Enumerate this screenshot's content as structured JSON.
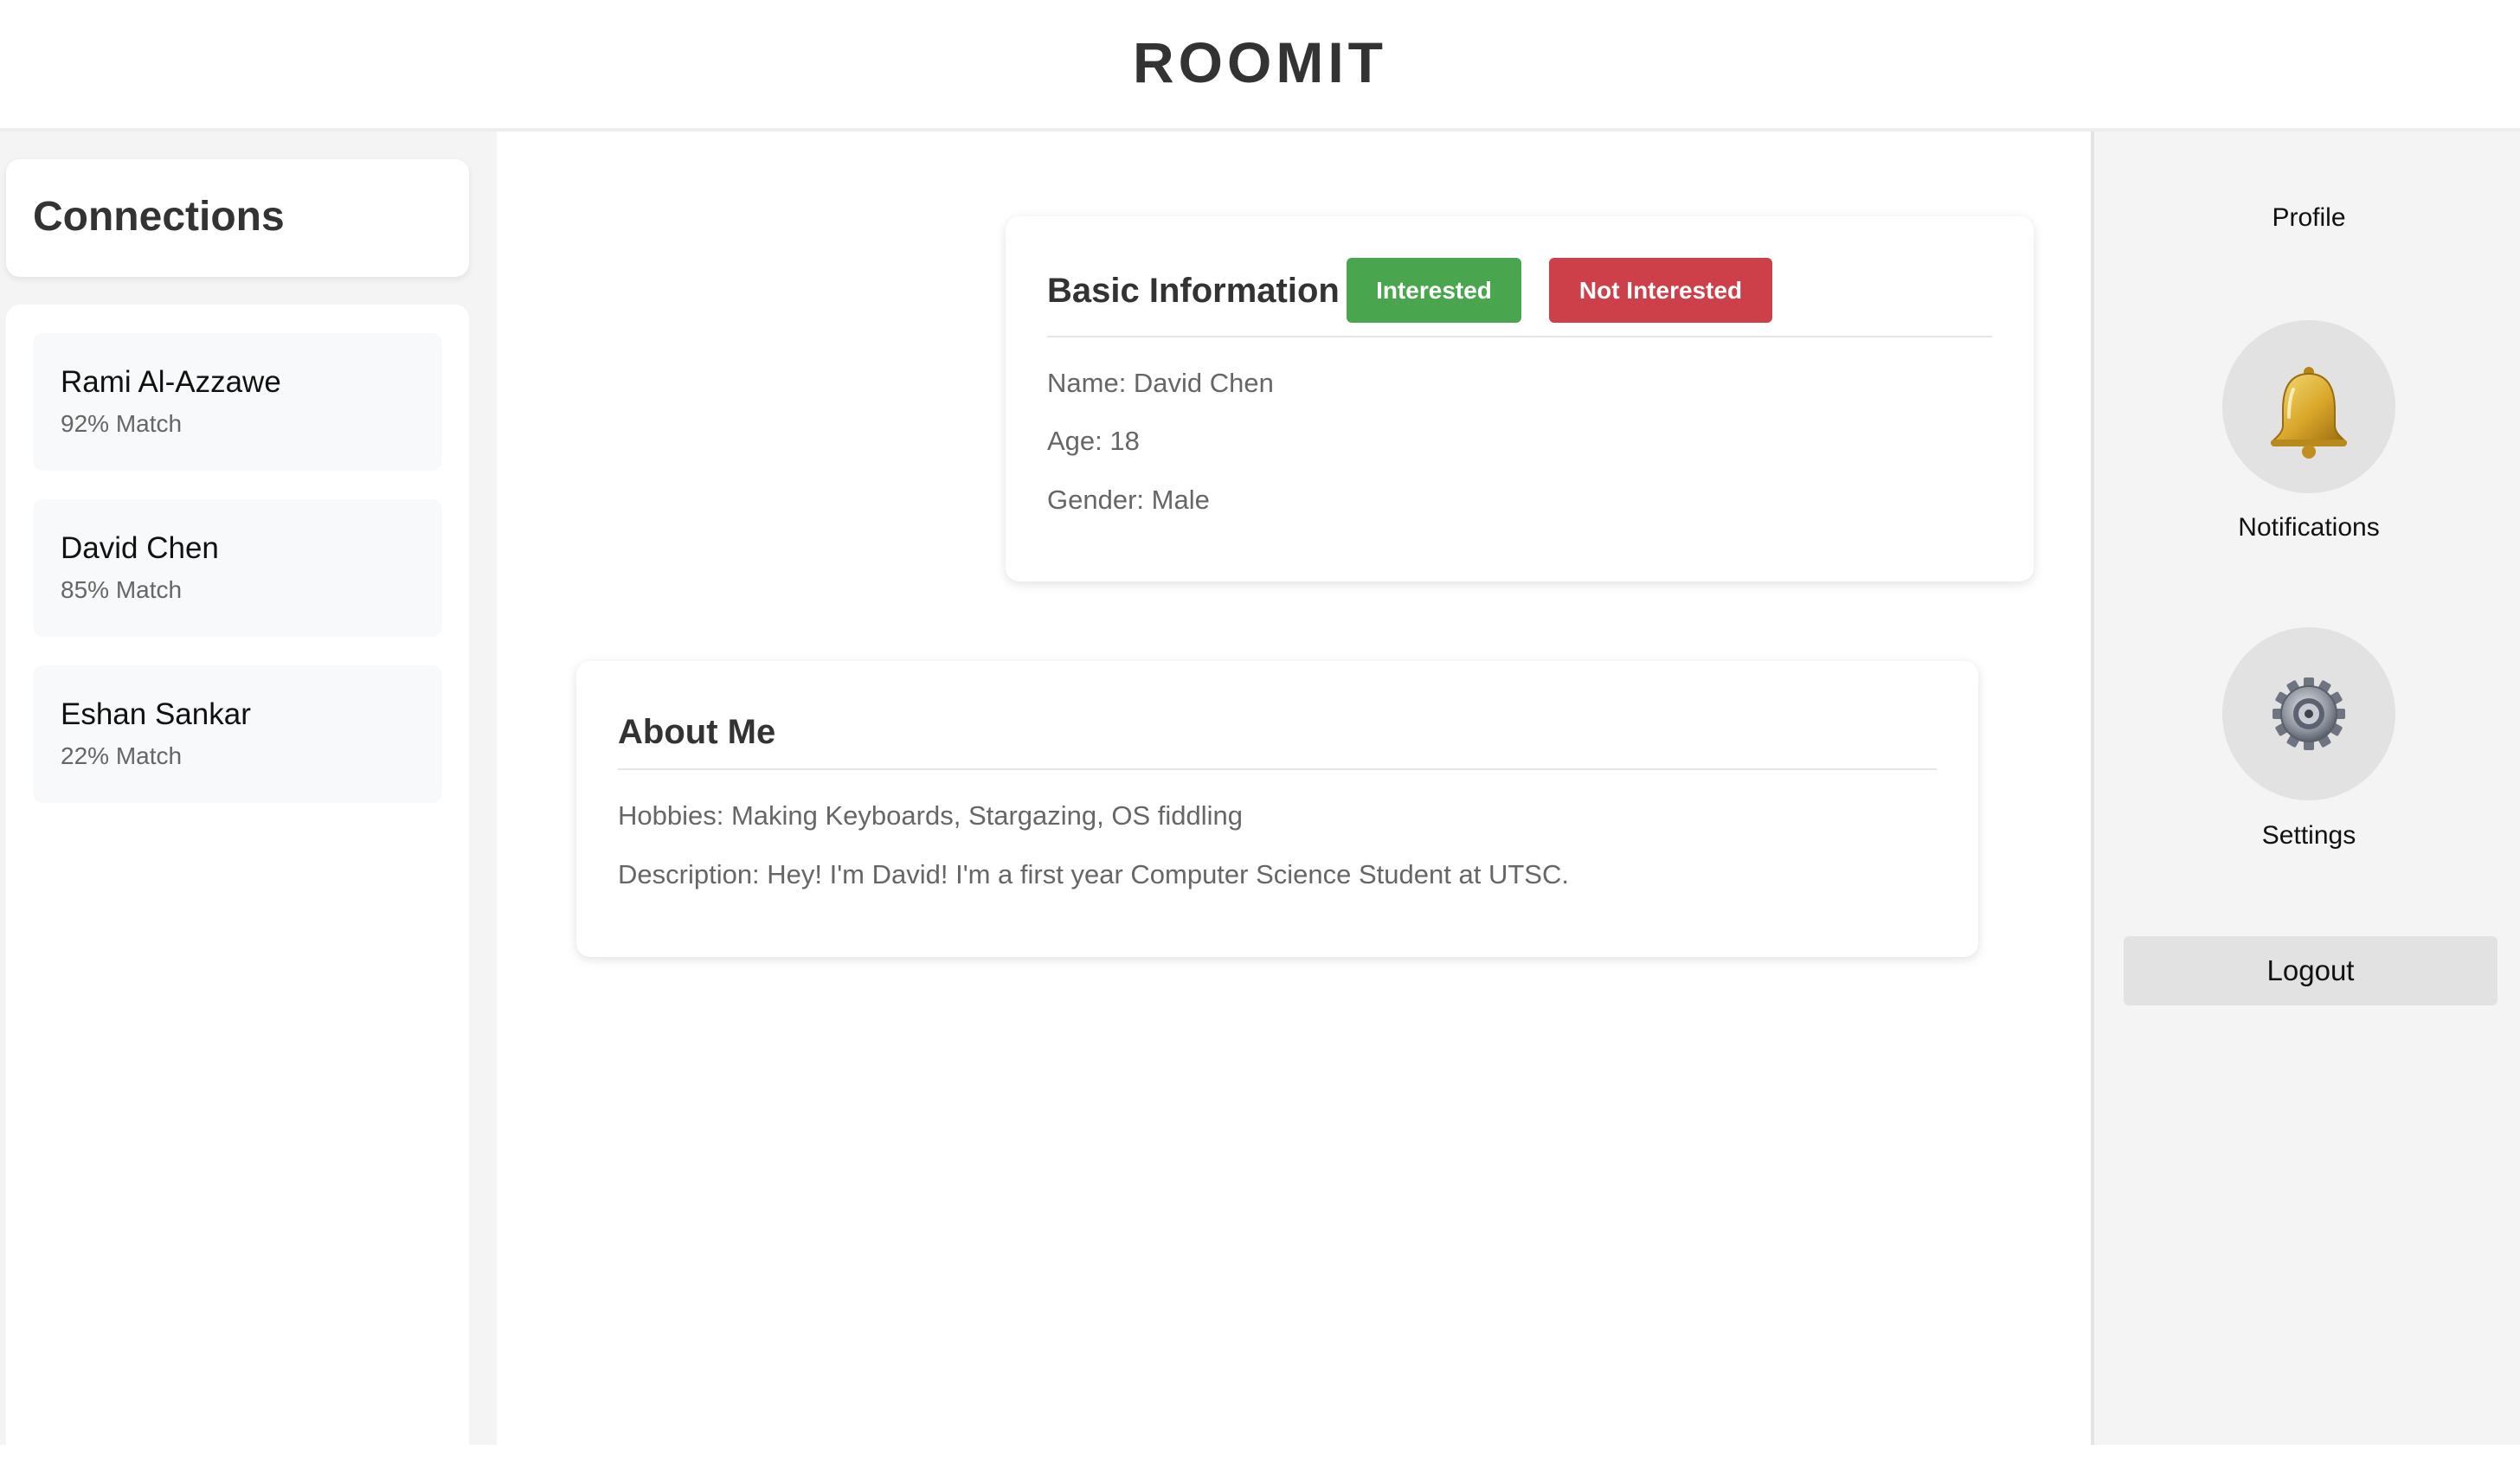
{
  "header": {
    "title": "ROOMIT"
  },
  "connections": {
    "title": "Connections",
    "items": [
      {
        "name": "Rami Al-Azzawe",
        "match": "92% Match"
      },
      {
        "name": "David Chen",
        "match": "85% Match"
      },
      {
        "name": "Eshan Sankar",
        "match": "22% Match"
      }
    ]
  },
  "profile": {
    "basic": {
      "title": "Basic Information",
      "interested_label": "Interested",
      "not_interested_label": "Not Interested",
      "name": "Name: David Chen",
      "age": "Age: 18",
      "gender": "Gender: Male"
    },
    "about": {
      "title": "About Me",
      "hobbies": "Hobbies: Making Keyboards, Stargazing, OS fiddling",
      "description": "Description: Hey! I'm David! I'm a first year Computer Science Student at UTSC."
    }
  },
  "nav": {
    "profile_label": "Profile",
    "notifications_label": "Notifications",
    "settings_label": "Settings",
    "logout_label": "Logout",
    "notifications_icon": "bell-icon",
    "settings_icon": "gear-icon"
  },
  "colors": {
    "interested": "#4aa64e",
    "not_interested": "#cd3f49",
    "title_text": "#333333",
    "body_text": "#666666",
    "sidebar_bg": "#f4f4f4"
  }
}
